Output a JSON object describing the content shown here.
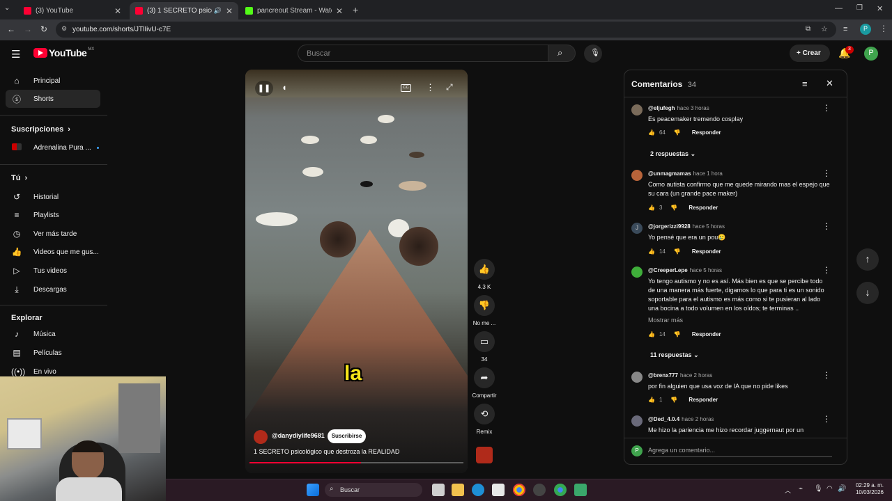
{
  "browser": {
    "tabs": [
      {
        "title": "(3) YouTube",
        "active": false
      },
      {
        "title": "(3) 1 SECRETO psicológico q",
        "active": true
      },
      {
        "title": "pancreout Stream - Watch Live",
        "active": false
      }
    ],
    "url": "youtube.com/shorts/JTlIivU-c7E",
    "profile_initial": "P"
  },
  "header": {
    "logo_text": "YouTube",
    "region": "MX",
    "search_placeholder": "Buscar",
    "create_label": "Crear",
    "notifications_count": "3",
    "avatar_initial": "P"
  },
  "sidebar": {
    "main": [
      {
        "label": "Principal",
        "icon": "home-icon"
      },
      {
        "label": "Shorts",
        "icon": "shorts-icon",
        "selected": true
      }
    ],
    "subs_heading": "Suscripciones",
    "subs": [
      {
        "label": "Adrenalina Pura ..."
      }
    ],
    "you_heading": "Tú",
    "you": [
      {
        "label": "Historial",
        "icon": "history-icon"
      },
      {
        "label": "Playlists",
        "icon": "playlists-icon"
      },
      {
        "label": "Ver más tarde",
        "icon": "watch-later-icon"
      },
      {
        "label": "Videos que me gus...",
        "icon": "liked-icon"
      },
      {
        "label": "Tus videos",
        "icon": "your-videos-icon"
      },
      {
        "label": "Descargas",
        "icon": "downloads-icon"
      }
    ],
    "explore_heading": "Explorar",
    "explore": [
      {
        "label": "Música",
        "icon": "music-icon"
      },
      {
        "label": "Películas",
        "icon": "movies-icon"
      },
      {
        "label": "En vivo",
        "icon": "live-icon"
      }
    ]
  },
  "short": {
    "caption_word": "la",
    "channel": "@danydiylife9681",
    "subscribe_label": "Suscribirse",
    "title": "1 SECRETO psicológico que destroza la REALIDAD",
    "progress_fraction": 0.52,
    "actions": {
      "like_count": "4.3 K",
      "dislike_label": "No me ...",
      "comments_count": "34",
      "share_label": "Compartir",
      "remix_label": "Remix"
    }
  },
  "comments": {
    "heading": "Comentarios",
    "count": "34",
    "add_placeholder": "Agrega un comentario...",
    "reply_label": "Responder",
    "items": [
      {
        "author": "@eljufegh",
        "time": "hace 3 horas",
        "text": "Es peacemaker tremendo cosplay",
        "likes": "64",
        "replies": "2 respuestas",
        "avatar_color": "#7a6b5a"
      },
      {
        "author": "@unmagmamas",
        "time": "hace 1 hora",
        "text": "Como autista confirmo que me quede mirando mas el espejo que su cara (un grande pace maker)",
        "likes": "3",
        "replies": "",
        "avatar_color": "#b8643a"
      },
      {
        "author": "@jorgerizzi9928",
        "time": "hace 5 horas",
        "text": "Yo pensé que era un pou🥲",
        "likes": "14",
        "replies": "",
        "avatar_color": "#3a4a5a",
        "avatar_letter": "J"
      },
      {
        "author": "@CreeperLepe",
        "time": "hace 5 horas",
        "text": "Yo tengo autismo y no es así. Más bien es que se percibe todo de una manera más fuerte, digamos lo que para ti es un sonido soportable para el autismo es más como si te pusieran al lado una bocina a todo volumen en los oídos; te terminas ..",
        "more": "Mostrar más",
        "likes": "14",
        "replies": "11 respuestas",
        "avatar_color": "#3fae3a"
      },
      {
        "author": "@brenx777",
        "time": "hace 2 horas",
        "text": "por fin alguien que usa voz de IA que no pide likes",
        "likes": "1",
        "replies": "",
        "avatar_color": "#888888"
      },
      {
        "author": "@Ded_4.0.4",
        "time": "hace 2 horas",
        "text": "Me hizo la pariencia me hizo recordar juggernaut por un",
        "likes": "",
        "replies": "",
        "avatar_color": "#6a6a7a"
      }
    ]
  },
  "taskbar": {
    "search_label": "Buscar",
    "time": "02:29 a. m.",
    "date": "10/03/2026"
  }
}
